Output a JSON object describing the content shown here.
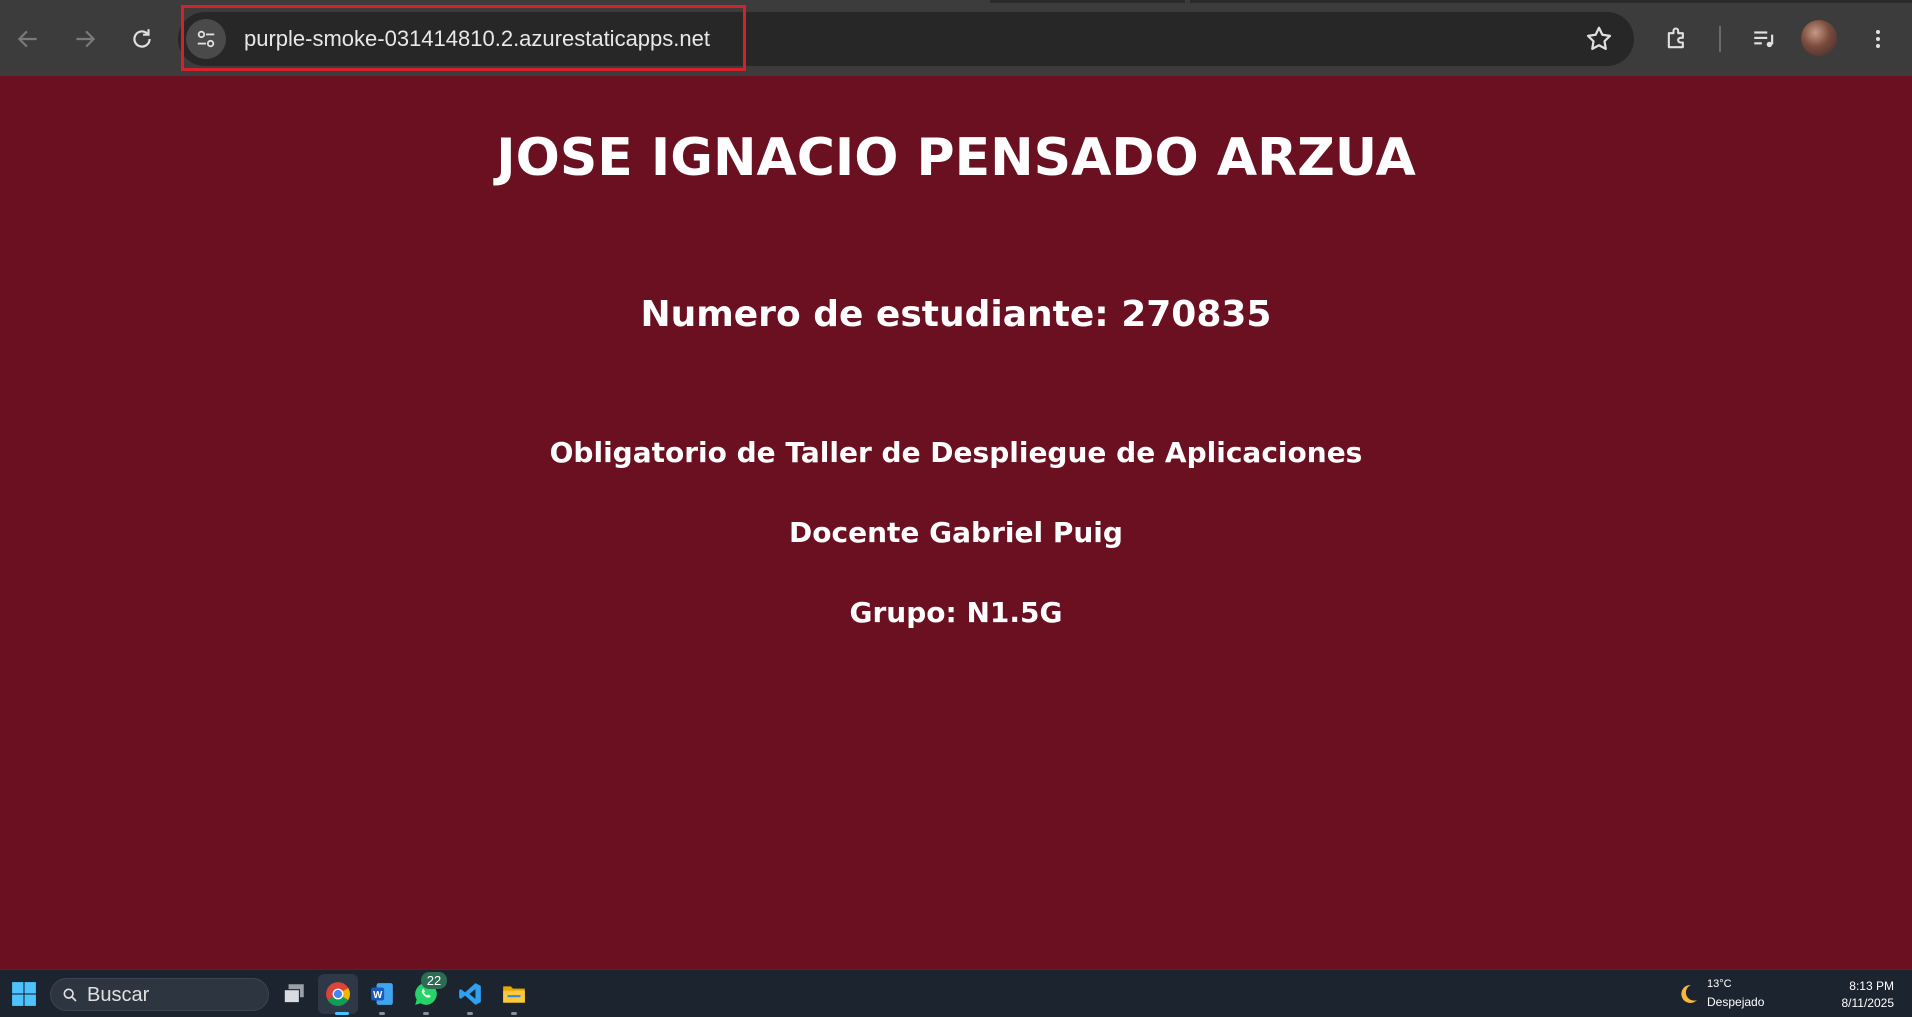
{
  "browser": {
    "url": "purple-smoke-031414810.2.azurestaticapps.net",
    "icons": {
      "back": "arrow-left-icon",
      "forward": "arrow-right-icon",
      "reload": "reload-icon",
      "site_info": "tune-icon",
      "bookmark": "star-icon",
      "extensions": "puzzle-icon",
      "media": "playlist-icon",
      "menu": "kebab-menu-icon"
    },
    "highlight_color": "#d3222c"
  },
  "page": {
    "background": "#6a1020",
    "name": "JOSE IGNACIO PENSADO ARZUA",
    "student_number": "Numero de estudiante: 270835",
    "course": "Obligatorio de Taller de Despliegue de Aplicaciones",
    "teacher": "Docente Gabriel Puig",
    "group": "Grupo: N1.5G"
  },
  "taskbar": {
    "search_placeholder": "Buscar",
    "whatsapp_badge": "22",
    "apps": [
      "windows-start-icon",
      "task-view-icon",
      "chrome-icon",
      "word-icon",
      "whatsapp-icon",
      "vscode-icon",
      "file-explorer-icon"
    ],
    "weather_temp": "13°C",
    "weather_condition": "Despejado",
    "time": "8:13 PM",
    "date": "8/11/2025"
  }
}
